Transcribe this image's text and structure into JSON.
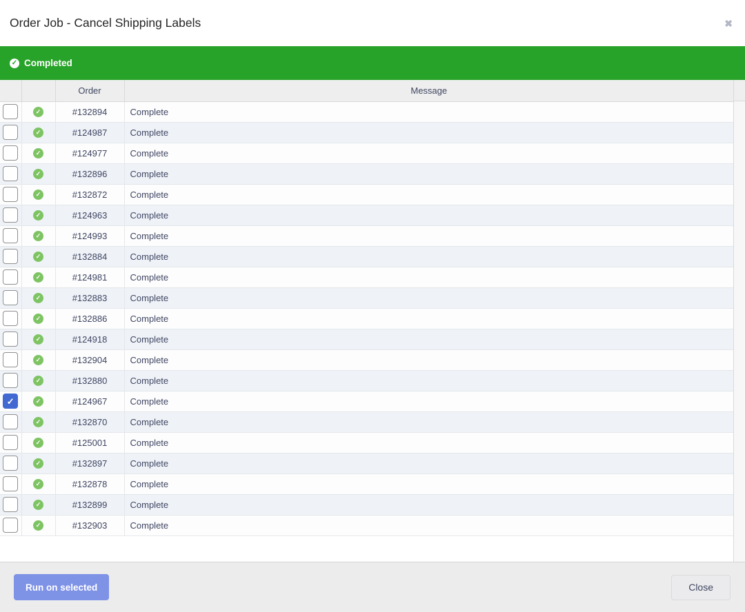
{
  "modal": {
    "title": "Order Job - Cancel Shipping Labels"
  },
  "banner": {
    "label": "Completed",
    "color": "#28a329",
    "icon": "check-circle"
  },
  "table": {
    "header": {
      "checkbox": "",
      "status": "",
      "order": "Order",
      "message": "Message"
    },
    "status_icon": "check-circle",
    "status_icon_color": "#7ec463",
    "checkbox_checked_color": "#4169d1",
    "rows": [
      {
        "order": "#132894",
        "message": "Complete",
        "checked": false
      },
      {
        "order": "#124987",
        "message": "Complete",
        "checked": false
      },
      {
        "order": "#124977",
        "message": "Complete",
        "checked": false
      },
      {
        "order": "#132896",
        "message": "Complete",
        "checked": false
      },
      {
        "order": "#132872",
        "message": "Complete",
        "checked": false
      },
      {
        "order": "#124963",
        "message": "Complete",
        "checked": false
      },
      {
        "order": "#124993",
        "message": "Complete",
        "checked": false
      },
      {
        "order": "#132884",
        "message": "Complete",
        "checked": false
      },
      {
        "order": "#124981",
        "message": "Complete",
        "checked": false
      },
      {
        "order": "#132883",
        "message": "Complete",
        "checked": false
      },
      {
        "order": "#132886",
        "message": "Complete",
        "checked": false
      },
      {
        "order": "#124918",
        "message": "Complete",
        "checked": false
      },
      {
        "order": "#132904",
        "message": "Complete",
        "checked": false
      },
      {
        "order": "#132880",
        "message": "Complete",
        "checked": false
      },
      {
        "order": "#124967",
        "message": "Complete",
        "checked": true
      },
      {
        "order": "#132870",
        "message": "Complete",
        "checked": false
      },
      {
        "order": "#125001",
        "message": "Complete",
        "checked": false
      },
      {
        "order": "#132897",
        "message": "Complete",
        "checked": false
      },
      {
        "order": "#132878",
        "message": "Complete",
        "checked": false
      },
      {
        "order": "#132899",
        "message": "Complete",
        "checked": false
      },
      {
        "order": "#132903",
        "message": "Complete",
        "checked": false
      }
    ]
  },
  "footer": {
    "run_button_label": "Run on selected",
    "run_button_color": "#7e92e6",
    "close_button_label": "Close"
  }
}
